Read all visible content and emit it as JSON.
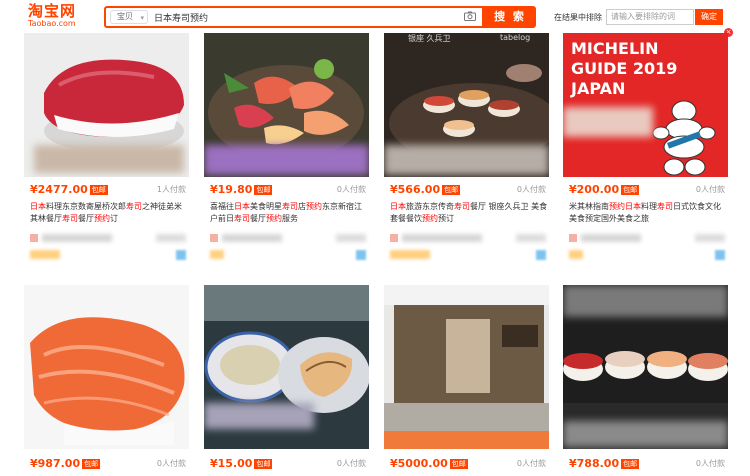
{
  "header": {
    "logo_cn": "淘宝网",
    "logo_en": "Taobao.com",
    "category": "宝贝",
    "search_value": "日本寿司预约",
    "search_button": "搜 索",
    "exclude_label": "在结果中排除",
    "exclude_placeholder": "请输入要排除的词",
    "exclude_button": "确定",
    "close_glyph": "×"
  },
  "items": [
    {
      "price": "¥2477.00",
      "tag": "包邮",
      "count": "1人付款",
      "title_parts": [
        "日本",
        "料理东京数寄屋桥次郎",
        "寿司",
        "之神徒弟米",
        "其林餐厅",
        "寿司",
        "餐厅",
        "预约",
        "订"
      ]
    },
    {
      "price": "¥19.80",
      "tag": "包邮",
      "count": "0人付款",
      "title_parts": [
        "喜福往",
        "日本",
        "美食明星",
        "寿司",
        "店",
        "预约",
        "东京新宿江户前日",
        "寿司",
        "餐厅",
        "预约",
        "服务"
      ]
    },
    {
      "price": "¥566.00",
      "tag": "包邮",
      "count": "0人付款",
      "title_parts": [
        "日本",
        "旅游东京传奇",
        "寿司",
        "餐厅 银座久兵卫 美食套餐餐饮",
        "预约",
        "预订"
      ]
    },
    {
      "price": "¥200.00",
      "tag": "包邮",
      "count": "0人付款",
      "title_parts": [
        "米其林指南",
        "预约",
        "日本",
        "料理",
        "寿司",
        "日式饮食文化美食预定国外美食之旅"
      ]
    },
    {
      "price": "¥987.00",
      "tag": "包邮",
      "count": "0人付款"
    },
    {
      "price": "¥15.00",
      "tag": "包邮",
      "count": "0人付款"
    },
    {
      "price": "¥5000.00",
      "tag": "包邮",
      "count": "0人付款"
    },
    {
      "price": "¥788.00",
      "tag": "包邮",
      "count": "0人付款"
    }
  ],
  "michelin": {
    "line1": "MICHELIN",
    "line2": "GUIDE 2019",
    "line3": "JAPAN"
  },
  "photo_text": {
    "item3_a": "银座 久兵卫",
    "item3_b": "tabelog"
  }
}
